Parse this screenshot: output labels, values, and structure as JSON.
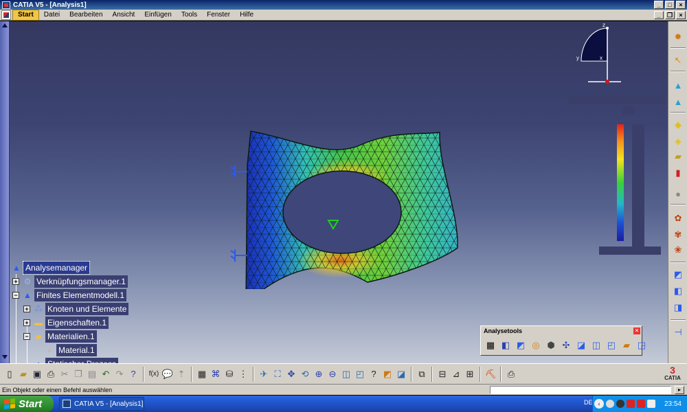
{
  "window": {
    "title": "CATIA V5 - [Analysis1]"
  },
  "menu": {
    "items": [
      {
        "label": "Start",
        "active": true
      },
      {
        "label": "Datei"
      },
      {
        "label": "Bearbeiten"
      },
      {
        "label": "Ansicht"
      },
      {
        "label": "Einfügen"
      },
      {
        "label": "Tools"
      },
      {
        "label": "Fenster"
      },
      {
        "label": "Hilfe"
      }
    ]
  },
  "compass": {
    "x_label": "x",
    "y_label": "y",
    "z_label": "z"
  },
  "colors": {
    "background_top": "#343860",
    "background_bottom": "#c4cad7",
    "tree_label_bg": "#3a3f72",
    "accent": "#f3c546"
  },
  "spec_tree": {
    "items": [
      {
        "label": "Analysemanager",
        "icon": "analysis-manager-icon",
        "selected": true
      },
      {
        "label": "Verknüpfungsmanager.1",
        "icon": "link-manager-icon"
      },
      {
        "label": "Finites Elementmodell.1",
        "icon": "fem-model-icon"
      },
      {
        "label": "Knoten und Elemente",
        "icon": "nodes-elements-icon"
      },
      {
        "label": "Eigenschaften.1",
        "icon": "folder-icon"
      },
      {
        "label": "Materialien.1",
        "icon": "folder-open-icon"
      },
      {
        "label": "Material.1",
        "icon": "material-sphere-icon"
      },
      {
        "label": "Statischer Prozess",
        "icon": "static-process-icon"
      }
    ]
  },
  "analysis_tools": {
    "title": "Analysetools",
    "close": "✕"
  },
  "status": {
    "message": "Ein Objekt oder einen Befehl auswählen",
    "command_value": ""
  },
  "taskbar": {
    "start_label": "Start",
    "task_label": "CATIA V5 - [Analysis1]",
    "language": "DE",
    "clock": "23:54"
  },
  "logo": {
    "text": "CATIA"
  }
}
